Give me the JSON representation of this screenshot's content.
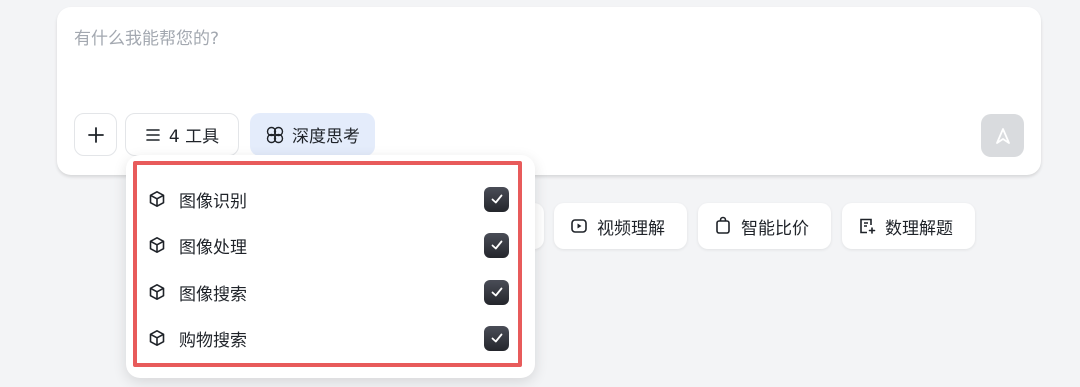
{
  "input": {
    "placeholder": "有什么我能帮您的?"
  },
  "toolbar": {
    "tools_label": "4 工具",
    "deep_think_label": "深度思考"
  },
  "chips": [
    {
      "label": "视频理解",
      "icon": "video-icon"
    },
    {
      "label": "智能比价",
      "icon": "shopping-bag-icon"
    },
    {
      "label": "数理解题",
      "icon": "math-doc-icon"
    }
  ],
  "tools_menu": {
    "items": [
      {
        "label": "图像识别",
        "checked": true,
        "icon": "cube-icon"
      },
      {
        "label": "图像处理",
        "checked": true,
        "icon": "cube-icon"
      },
      {
        "label": "图像搜索",
        "checked": true,
        "icon": "cube-icon"
      },
      {
        "label": "购物搜索",
        "checked": true,
        "icon": "cube-icon"
      }
    ]
  },
  "colors": {
    "page_bg": "#f3f4f6",
    "deep_think_bg": "#e4ecfb",
    "highlight": "#e85b5b",
    "checkbox": "#2e3038"
  }
}
